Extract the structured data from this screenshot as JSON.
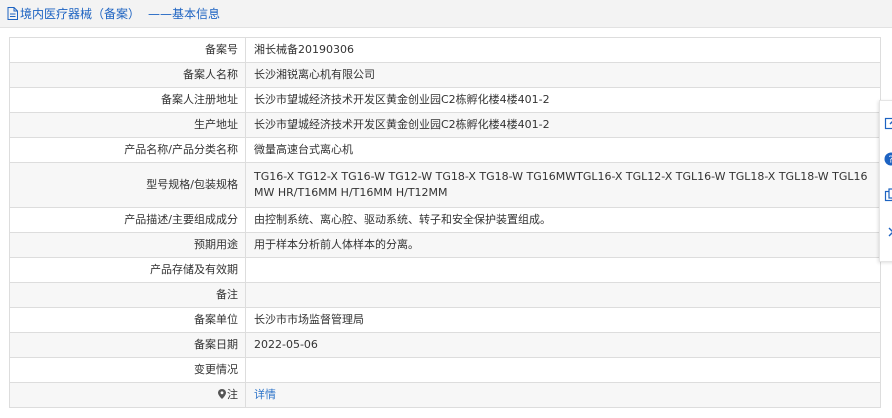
{
  "header": {
    "title": "境内医疗器械（备案）",
    "separator": "——",
    "subtitle": "基本信息"
  },
  "rows": [
    {
      "label": "备案号",
      "value": "湘长械备20190306"
    },
    {
      "label": "备案人名称",
      "value": "长沙湘锐离心机有限公司"
    },
    {
      "label": "备案人注册地址",
      "value": "长沙市望城经济技术开发区黄金创业园C2栋孵化楼4楼401-2"
    },
    {
      "label": "生产地址",
      "value": "长沙市望城经济技术开发区黄金创业园C2栋孵化楼4楼401-2"
    },
    {
      "label": "产品名称/产品分类名称",
      "value": "微量高速台式离心机"
    },
    {
      "label": "型号规格/包装规格",
      "value": "TG16-X TG12-X TG16-W TG12-W TG18-X TG18-W TG16MWTGL16-X TGL12-X TGL16-W TGL18-X TGL18-W TGL16MW HR/T16MM H/T16MM H/T12MM"
    },
    {
      "label": "产品描述/主要组成成分",
      "value": "由控制系统、离心腔、驱动系统、转子和安全保护装置组成。"
    },
    {
      "label": "预期用途",
      "value": "用于样本分析前人体样本的分离。"
    },
    {
      "label": "产品存储及有效期",
      "value": ""
    },
    {
      "label": "备注",
      "value": ""
    },
    {
      "label": "备案单位",
      "value": "长沙市市场监督管理局"
    },
    {
      "label": "备案日期",
      "value": "2022-05-06"
    },
    {
      "label": "变更情况",
      "value": ""
    }
  ],
  "note_row": {
    "label": "注",
    "link": "详情"
  },
  "side_tools": [
    "edit-icon",
    "help-icon",
    "copy-icon",
    "chevron-right-icon"
  ],
  "colors": {
    "link": "#2a72c8",
    "header_text": "#1d63c2",
    "border": "#dddddd"
  }
}
